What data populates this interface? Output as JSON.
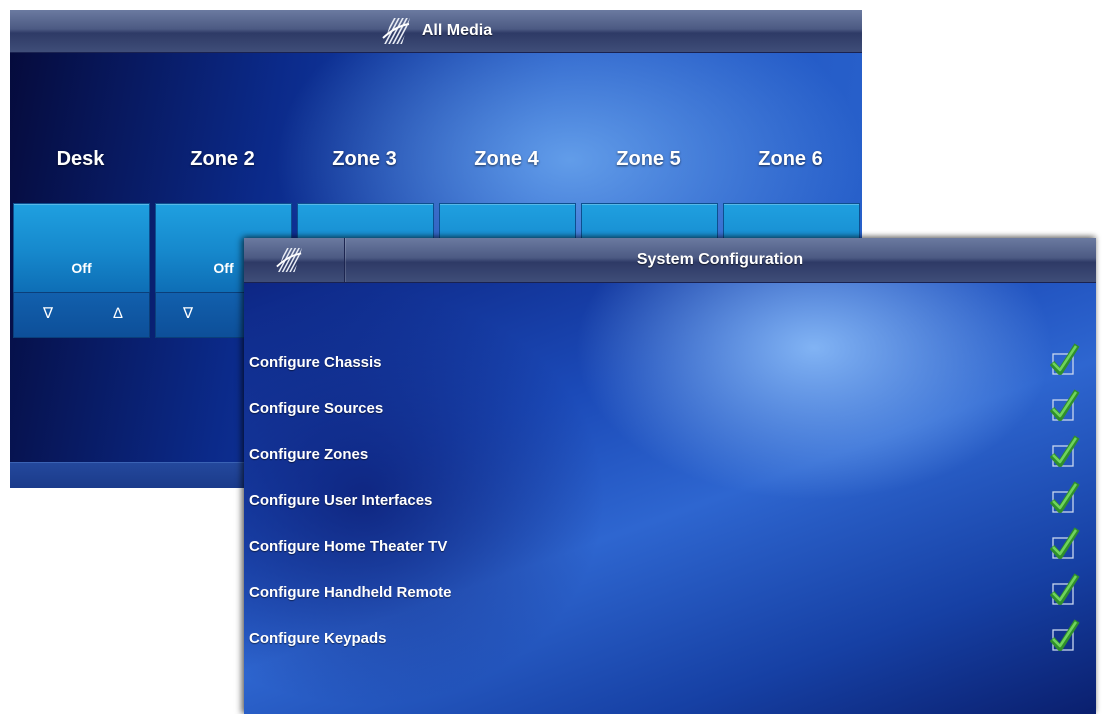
{
  "all_media": {
    "title": "All Media",
    "logo_icon": "striped-logo-icon",
    "zones": [
      {
        "name": "Desk",
        "status": "Off",
        "down_icon": "triangle-down-icon",
        "up_icon": "triangle-up-icon",
        "down_glyph": "∇",
        "up_glyph": "∆"
      },
      {
        "name": "Zone 2",
        "status": "Off",
        "down_icon": "triangle-down-icon",
        "down_glyph": "∇"
      },
      {
        "name": "Zone 3"
      },
      {
        "name": "Zone 4"
      },
      {
        "name": "Zone 5"
      },
      {
        "name": "Zone 6"
      }
    ]
  },
  "system_configuration": {
    "title": "System Configuration",
    "logo_icon": "striped-logo-icon",
    "check_icon": "green-checkmark-icon",
    "check_color": "#3fa83a",
    "items": [
      {
        "label": "Configure Chassis",
        "checked": true
      },
      {
        "label": "Configure Sources",
        "checked": true
      },
      {
        "label": "Configure Zones",
        "checked": true
      },
      {
        "label": "Configure User Interfaces",
        "checked": true
      },
      {
        "label": "Configure Home Theater TV",
        "checked": true
      },
      {
        "label": "Configure Handheld Remote",
        "checked": true
      },
      {
        "label": "Configure Keypads",
        "checked": true
      }
    ]
  }
}
